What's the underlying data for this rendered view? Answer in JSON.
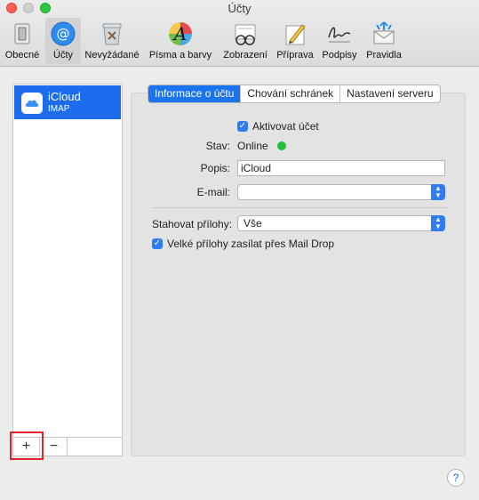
{
  "window": {
    "title": "Účty"
  },
  "toolbar": {
    "items": [
      {
        "label": "Obecné",
        "icon": "switch-icon"
      },
      {
        "label": "Účty",
        "icon": "at-sign-icon"
      },
      {
        "label": "Nevyžádané",
        "icon": "junk-trash-icon"
      },
      {
        "label": "Písma a barvy",
        "icon": "fonts-colors-icon"
      },
      {
        "label": "Zobrazení",
        "icon": "glasses-icon"
      },
      {
        "label": "Příprava",
        "icon": "pencil-paper-icon"
      },
      {
        "label": "Podpisy",
        "icon": "signature-icon"
      },
      {
        "label": "Pravidla",
        "icon": "rules-envelope-icon"
      }
    ],
    "active_index": 1
  },
  "accounts": {
    "items": [
      {
        "name": "iCloud",
        "type": "IMAP",
        "icon": "icloud-icon"
      }
    ],
    "add_label": "+",
    "remove_label": "−"
  },
  "tabs": [
    {
      "label": "Informace o účtu",
      "active": true
    },
    {
      "label": "Chování schránek",
      "active": false
    },
    {
      "label": "Nastavení serveru",
      "active": false
    }
  ],
  "form": {
    "enable_label": "Aktivovat účet",
    "enable_checked": true,
    "status_label": "Stav:",
    "status_value": "Online",
    "status_color": "#22c13a",
    "description_label": "Popis:",
    "description_value": "iCloud",
    "email_label": "E-mail:",
    "email_value": "",
    "download_label": "Stahovat přílohy:",
    "download_value": "Vše",
    "maildrop_label": "Velké přílohy zasílat přes Mail Drop",
    "maildrop_checked": true
  },
  "help": {
    "label": "?"
  }
}
